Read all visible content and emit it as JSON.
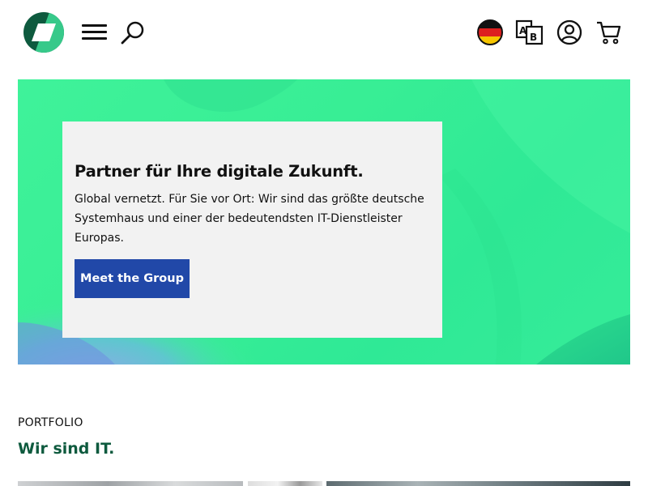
{
  "header": {
    "logo_icon": "brand-logo-icon",
    "menu_icon": "hamburger-menu-icon",
    "search_icon": "search-icon",
    "language_flag_icon": "german-flag-icon",
    "translate_icon": "translate-icon",
    "account_icon": "user-account-icon",
    "cart_icon": "shopping-cart-icon"
  },
  "hero": {
    "title": "Partner für Ihre digitale Zukunft.",
    "text": "Global vernetzt. Für Sie vor Ort: Wir sind das größte deutsche Systemhaus und einer der bedeutendsten IT-Dienstleister Europas.",
    "cta_label": "Meet the Group"
  },
  "portfolio": {
    "eyebrow": "PORTFOLIO",
    "title": "Wir sind IT."
  },
  "colors": {
    "brand_dark_green": "#0e5a3e",
    "brand_green": "#3ff29a",
    "cta_blue": "#2148a8",
    "card_background": "#f2f2f2"
  }
}
